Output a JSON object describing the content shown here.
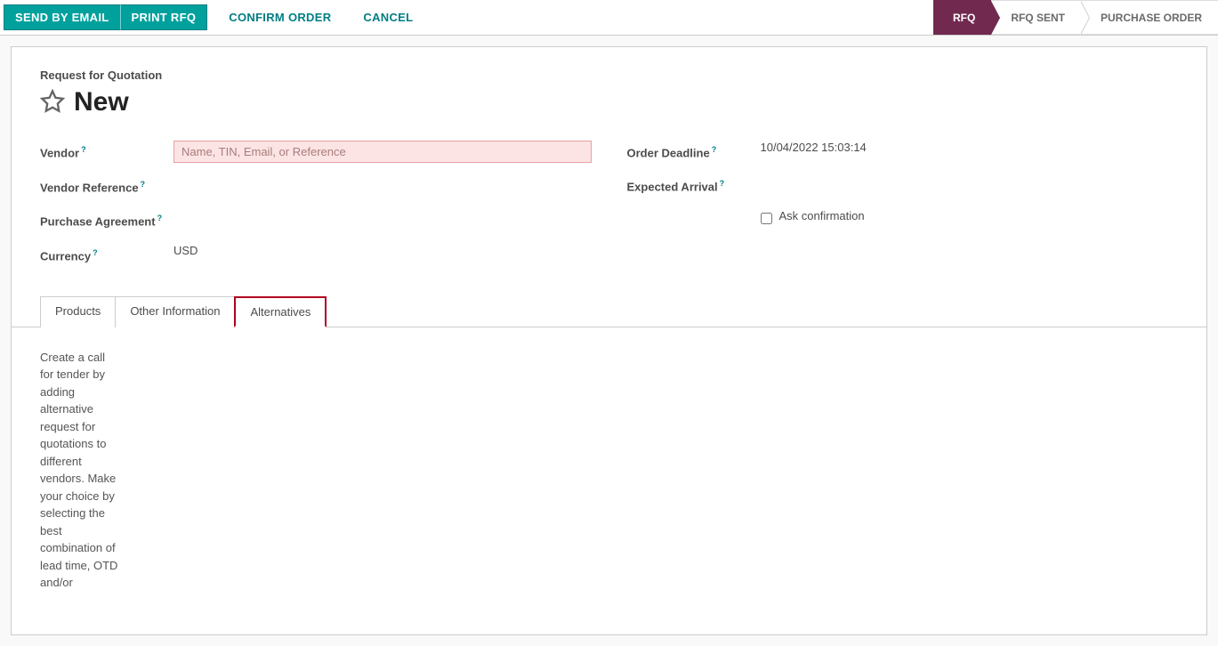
{
  "toolbar": {
    "send_email": "SEND BY EMAIL",
    "print_rfq": "PRINT RFQ",
    "confirm_order": "CONFIRM ORDER",
    "cancel": "CANCEL"
  },
  "status_steps": {
    "rfq": "RFQ",
    "rfq_sent": "RFQ SENT",
    "purchase_order": "PURCHASE ORDER"
  },
  "form": {
    "subtitle": "Request for Quotation",
    "title": "New",
    "vendor_label": "Vendor",
    "vendor_placeholder": "Name, TIN, Email, or Reference",
    "vendor_ref_label": "Vendor Reference",
    "purchase_agr_label": "Purchase Agreement",
    "currency_label": "Currency",
    "currency_value": "USD",
    "order_deadline_label": "Order Deadline",
    "order_deadline_value": "10/04/2022 15:03:14",
    "expected_arrival_label": "Expected Arrival",
    "ask_confirmation_label": "Ask confirmation",
    "help": "?"
  },
  "tabs": {
    "products": "Products",
    "other_info": "Other Information",
    "alternatives": "Alternatives"
  },
  "alternatives_text": "Create a call for tender by adding alternative request for quotations to different vendors. Make your choice by selecting the best combination of lead time, OTD and/or"
}
